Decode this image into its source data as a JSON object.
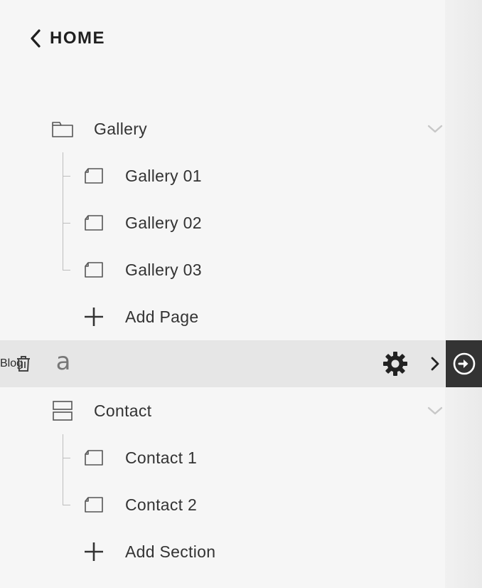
{
  "header": {
    "back_label": "HOME"
  },
  "nav": {
    "gallery": {
      "label": "Gallery",
      "pages": [
        {
          "label": "Gallery 01"
        },
        {
          "label": "Gallery 02"
        },
        {
          "label": "Gallery 03"
        }
      ],
      "add_label": "Add Page"
    },
    "blog": {
      "label": "Blog"
    },
    "contact": {
      "label": "Contact",
      "sections": [
        {
          "label": "Contact 1"
        },
        {
          "label": "Contact 2"
        }
      ],
      "add_label": "Add Section"
    }
  },
  "colors": {
    "background": "#f6f6f6",
    "highlight_row": "#e6e6e6",
    "go_button": "#333333",
    "text": "#333333"
  },
  "icons": {
    "back": "chevron-left-icon",
    "folder": "folder-icon",
    "page": "page-icon",
    "add": "plus-icon",
    "trash": "trash-icon",
    "blog": "blog-icon",
    "settings": "gear-icon",
    "index": "index-icon",
    "expand": "chevron-down-icon",
    "go": "arrow-circle-right-icon"
  }
}
